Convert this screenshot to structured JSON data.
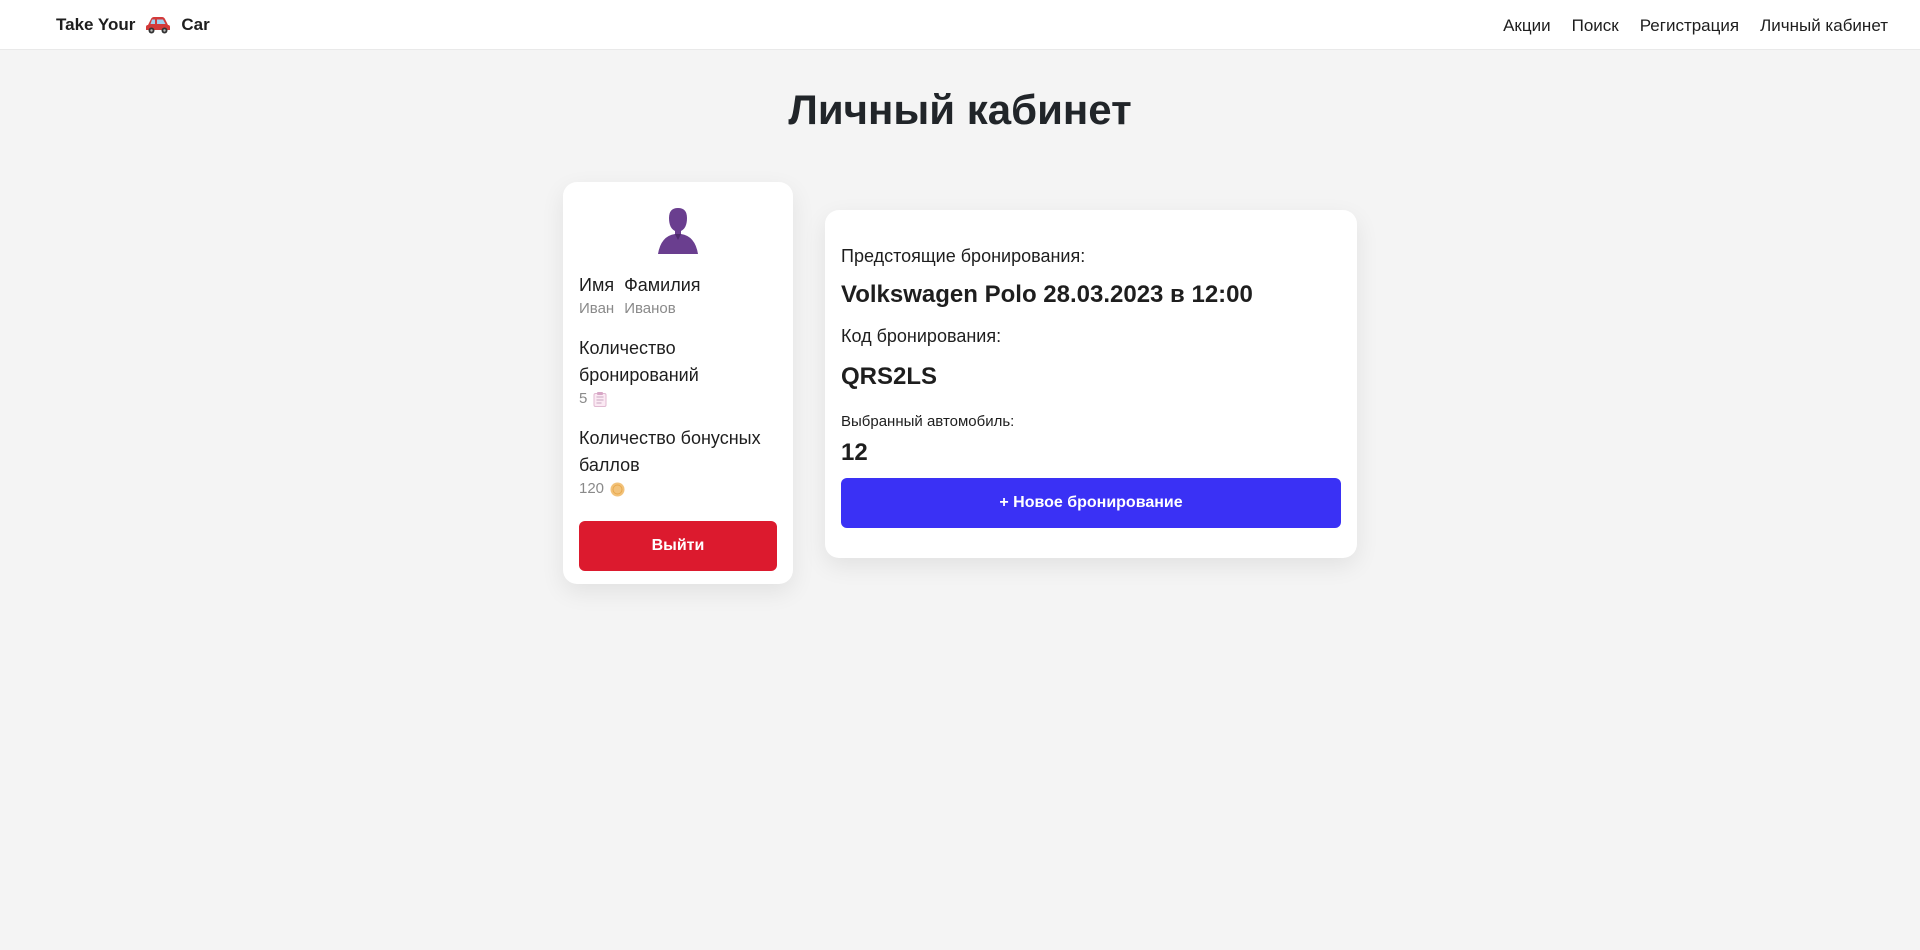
{
  "nav": {
    "brand_left": "Take Your",
    "brand_right": "Car",
    "brand_icon": "car-icon",
    "links": [
      "Акции",
      "Поиск",
      "Регистрация",
      "Личный кабинет"
    ]
  },
  "page": {
    "title": "Личный кабинет"
  },
  "profile": {
    "avatar_icon": "user-silhouette-icon",
    "first_name_label": "Имя",
    "last_name_label": "Фамилия",
    "first_name": "Иван",
    "last_name": "Иванов",
    "bookings_label": "Количество бронирований",
    "bookings_count": "5",
    "bookings_icon": "notepad-icon",
    "bonus_label": "Количество бонусных баллов",
    "bonus_count": "120",
    "bonus_icon": "coin-icon",
    "logout_label": "Выйти"
  },
  "booking": {
    "upcoming_label": "Предстоящие бронирования:",
    "upcoming_value": "Volkswagen Polo 28.03.2023 в 12:00",
    "code_label": "Код бронирования:",
    "code_value": "QRS2LS",
    "car_label": "Выбранный автомобиль:",
    "car_value": "12",
    "new_booking_label": "+ Новое бронирование"
  },
  "colors": {
    "logout": "#dc1a2e",
    "new_booking": "#3a31f5",
    "avatar": "#6a3e8f",
    "coin": "#f2c27a",
    "background": "#f4f4f4"
  }
}
